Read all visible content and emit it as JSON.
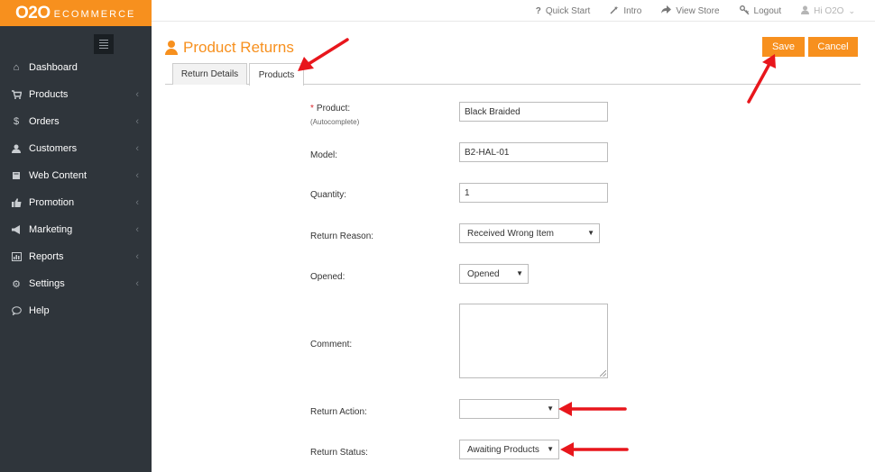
{
  "brand": {
    "logo_main": "O2O",
    "logo_sub": "ECOMMERCE",
    "accent": "#f7901e",
    "sidebar_bg": "#2f353b"
  },
  "topnav": [
    {
      "icon": "question-icon",
      "label": "Quick Start"
    },
    {
      "icon": "magic-wand-icon",
      "label": "Intro"
    },
    {
      "icon": "share-icon",
      "label": "View Store"
    },
    {
      "icon": "key-icon",
      "label": "Logout"
    }
  ],
  "user_menu": {
    "icon": "user-icon",
    "label": "Hi O2O"
  },
  "sidebar": {
    "items": [
      {
        "icon": "home-icon",
        "label": "Dashboard"
      },
      {
        "icon": "cart-icon",
        "label": "Products"
      },
      {
        "icon": "dollar-icon",
        "label": "Orders"
      },
      {
        "icon": "user-icon",
        "label": "Customers"
      },
      {
        "icon": "book-icon",
        "label": "Web Content"
      },
      {
        "icon": "thumbs-up-icon",
        "label": "Promotion"
      },
      {
        "icon": "bullhorn-icon",
        "label": "Marketing"
      },
      {
        "icon": "bar-chart-icon",
        "label": "Reports"
      },
      {
        "icon": "cogs-icon",
        "label": "Settings"
      },
      {
        "icon": "comment-icon",
        "label": "Help"
      }
    ]
  },
  "header": {
    "title": "Product Returns",
    "title_icon": "user-icon"
  },
  "actions": {
    "save": "Save",
    "cancel": "Cancel"
  },
  "tabs": [
    {
      "label": "Return Details",
      "active": false
    },
    {
      "label": "Products",
      "active": true
    }
  ],
  "form": {
    "product": {
      "label": "Product:",
      "required_mark": "*",
      "hint": "(Autocomplete)",
      "value": "Black Braided"
    },
    "model": {
      "label": "Model:",
      "value": "B2-HAL-01"
    },
    "quantity": {
      "label": "Quantity:",
      "value": "1"
    },
    "return_reason": {
      "label": "Return Reason:",
      "value": "Received Wrong Item"
    },
    "opened": {
      "label": "Opened:",
      "value": "Opened"
    },
    "comment": {
      "label": "Comment:",
      "value": ""
    },
    "return_action": {
      "label": "Return Action:",
      "value": ""
    },
    "return_status": {
      "label": "Return Status:",
      "value": "Awaiting Products"
    }
  },
  "annotation_color": "#e8161c"
}
